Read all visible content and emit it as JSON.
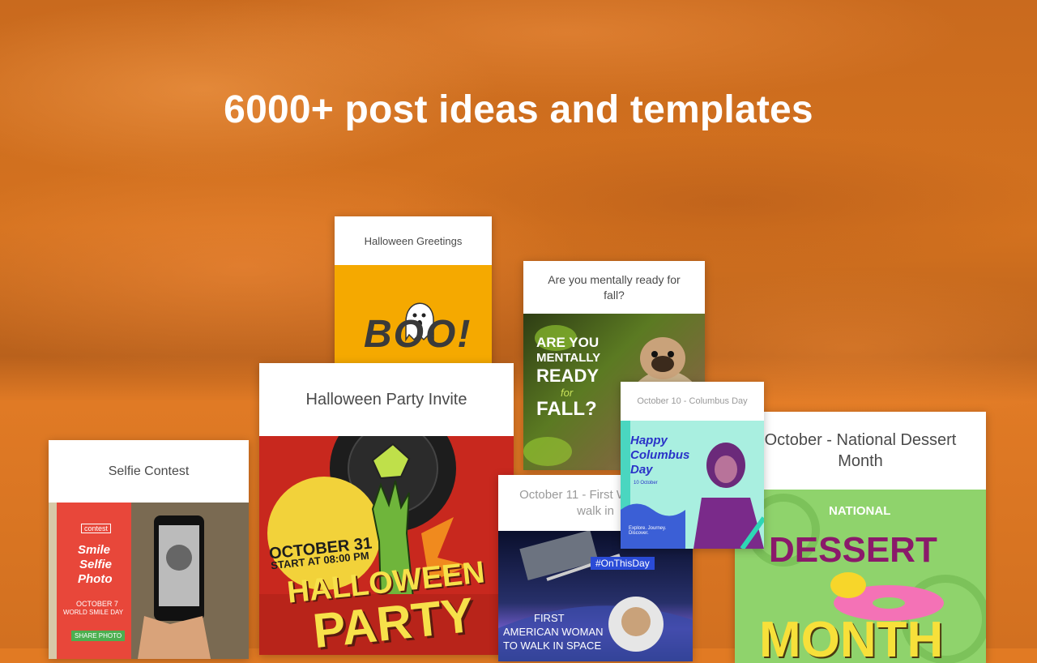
{
  "headline": "6000+ post ideas and templates",
  "colors": {
    "background": "#e17a23",
    "headline": "#ffffff",
    "card_title": "#4a4a4a"
  },
  "cards": {
    "greetings": {
      "title": "Halloween Greetings",
      "art_text": "BOO!"
    },
    "fall": {
      "title": "Are you mentally ready for fall?",
      "art_lines": [
        "ARE YOU",
        "MENTALLY",
        "READY",
        "for",
        "FALL?"
      ]
    },
    "party": {
      "title": "Halloween Party Invite",
      "date_line1": "OCTOBER 31",
      "date_line2": "START AT 08:00 PM",
      "word1": "HALLOWEEN",
      "word2": "PARTY"
    },
    "selfie": {
      "title": "Selfie Contest",
      "tag": "contest",
      "line1": "Smile",
      "line2": "Selfie",
      "line3": "Photo",
      "date": "OCTOBER 7",
      "day": "WORLD SMILE DAY",
      "button": "SHARE PHOTO"
    },
    "woman": {
      "title": "October 11 - First Woman to walk in",
      "hashtag": "#OnThisDay",
      "line1": "FIRST",
      "line2": "AMERICAN WOMAN",
      "line3": "TO WALK IN SPACE"
    },
    "columbus": {
      "title": "October 10 - Columbus Day",
      "line1": "Happy",
      "line2": "Columbus",
      "line3": "Day",
      "date": "10 October",
      "tagline": "Explore. Journey. Discover."
    },
    "dessert": {
      "title": "October - National Dessert Month",
      "line1": "NATIONAL",
      "line2": "DESSERT",
      "line3": "MONTH"
    }
  }
}
